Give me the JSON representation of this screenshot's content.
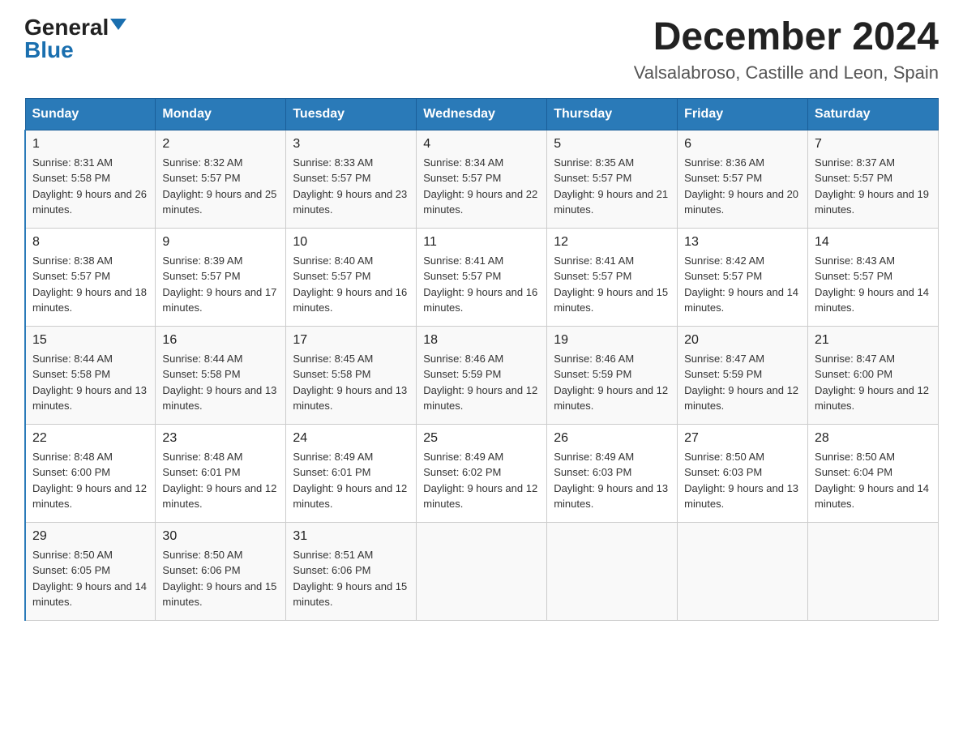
{
  "logo": {
    "general": "General",
    "blue": "Blue"
  },
  "title": "December 2024",
  "location": "Valsalabroso, Castille and Leon, Spain",
  "days_of_week": [
    "Sunday",
    "Monday",
    "Tuesday",
    "Wednesday",
    "Thursday",
    "Friday",
    "Saturday"
  ],
  "weeks": [
    [
      {
        "day": "1",
        "sunrise": "8:31 AM",
        "sunset": "5:58 PM",
        "daylight": "9 hours and 26 minutes."
      },
      {
        "day": "2",
        "sunrise": "8:32 AM",
        "sunset": "5:57 PM",
        "daylight": "9 hours and 25 minutes."
      },
      {
        "day": "3",
        "sunrise": "8:33 AM",
        "sunset": "5:57 PM",
        "daylight": "9 hours and 23 minutes."
      },
      {
        "day": "4",
        "sunrise": "8:34 AM",
        "sunset": "5:57 PM",
        "daylight": "9 hours and 22 minutes."
      },
      {
        "day": "5",
        "sunrise": "8:35 AM",
        "sunset": "5:57 PM",
        "daylight": "9 hours and 21 minutes."
      },
      {
        "day": "6",
        "sunrise": "8:36 AM",
        "sunset": "5:57 PM",
        "daylight": "9 hours and 20 minutes."
      },
      {
        "day": "7",
        "sunrise": "8:37 AM",
        "sunset": "5:57 PM",
        "daylight": "9 hours and 19 minutes."
      }
    ],
    [
      {
        "day": "8",
        "sunrise": "8:38 AM",
        "sunset": "5:57 PM",
        "daylight": "9 hours and 18 minutes."
      },
      {
        "day": "9",
        "sunrise": "8:39 AM",
        "sunset": "5:57 PM",
        "daylight": "9 hours and 17 minutes."
      },
      {
        "day": "10",
        "sunrise": "8:40 AM",
        "sunset": "5:57 PM",
        "daylight": "9 hours and 16 minutes."
      },
      {
        "day": "11",
        "sunrise": "8:41 AM",
        "sunset": "5:57 PM",
        "daylight": "9 hours and 16 minutes."
      },
      {
        "day": "12",
        "sunrise": "8:41 AM",
        "sunset": "5:57 PM",
        "daylight": "9 hours and 15 minutes."
      },
      {
        "day": "13",
        "sunrise": "8:42 AM",
        "sunset": "5:57 PM",
        "daylight": "9 hours and 14 minutes."
      },
      {
        "day": "14",
        "sunrise": "8:43 AM",
        "sunset": "5:57 PM",
        "daylight": "9 hours and 14 minutes."
      }
    ],
    [
      {
        "day": "15",
        "sunrise": "8:44 AM",
        "sunset": "5:58 PM",
        "daylight": "9 hours and 13 minutes."
      },
      {
        "day": "16",
        "sunrise": "8:44 AM",
        "sunset": "5:58 PM",
        "daylight": "9 hours and 13 minutes."
      },
      {
        "day": "17",
        "sunrise": "8:45 AM",
        "sunset": "5:58 PM",
        "daylight": "9 hours and 13 minutes."
      },
      {
        "day": "18",
        "sunrise": "8:46 AM",
        "sunset": "5:59 PM",
        "daylight": "9 hours and 12 minutes."
      },
      {
        "day": "19",
        "sunrise": "8:46 AM",
        "sunset": "5:59 PM",
        "daylight": "9 hours and 12 minutes."
      },
      {
        "day": "20",
        "sunrise": "8:47 AM",
        "sunset": "5:59 PM",
        "daylight": "9 hours and 12 minutes."
      },
      {
        "day": "21",
        "sunrise": "8:47 AM",
        "sunset": "6:00 PM",
        "daylight": "9 hours and 12 minutes."
      }
    ],
    [
      {
        "day": "22",
        "sunrise": "8:48 AM",
        "sunset": "6:00 PM",
        "daylight": "9 hours and 12 minutes."
      },
      {
        "day": "23",
        "sunrise": "8:48 AM",
        "sunset": "6:01 PM",
        "daylight": "9 hours and 12 minutes."
      },
      {
        "day": "24",
        "sunrise": "8:49 AM",
        "sunset": "6:01 PM",
        "daylight": "9 hours and 12 minutes."
      },
      {
        "day": "25",
        "sunrise": "8:49 AM",
        "sunset": "6:02 PM",
        "daylight": "9 hours and 12 minutes."
      },
      {
        "day": "26",
        "sunrise": "8:49 AM",
        "sunset": "6:03 PM",
        "daylight": "9 hours and 13 minutes."
      },
      {
        "day": "27",
        "sunrise": "8:50 AM",
        "sunset": "6:03 PM",
        "daylight": "9 hours and 13 minutes."
      },
      {
        "day": "28",
        "sunrise": "8:50 AM",
        "sunset": "6:04 PM",
        "daylight": "9 hours and 14 minutes."
      }
    ],
    [
      {
        "day": "29",
        "sunrise": "8:50 AM",
        "sunset": "6:05 PM",
        "daylight": "9 hours and 14 minutes."
      },
      {
        "day": "30",
        "sunrise": "8:50 AM",
        "sunset": "6:06 PM",
        "daylight": "9 hours and 15 minutes."
      },
      {
        "day": "31",
        "sunrise": "8:51 AM",
        "sunset": "6:06 PM",
        "daylight": "9 hours and 15 minutes."
      },
      null,
      null,
      null,
      null
    ]
  ]
}
